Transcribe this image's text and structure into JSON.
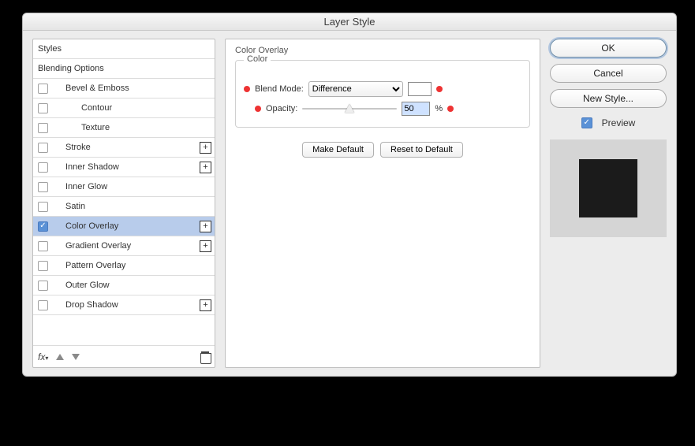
{
  "window": {
    "title": "Layer Style"
  },
  "left": {
    "styles_header": "Styles",
    "blending_options": "Blending Options",
    "items": [
      {
        "label": "Bevel & Emboss",
        "checked": false,
        "plus": false,
        "indent": 1
      },
      {
        "label": "Contour",
        "checked": false,
        "plus": false,
        "indent": 2
      },
      {
        "label": "Texture",
        "checked": false,
        "plus": false,
        "indent": 2
      },
      {
        "label": "Stroke",
        "checked": false,
        "plus": true,
        "indent": 1
      },
      {
        "label": "Inner Shadow",
        "checked": false,
        "plus": true,
        "indent": 1
      },
      {
        "label": "Inner Glow",
        "checked": false,
        "plus": false,
        "indent": 1
      },
      {
        "label": "Satin",
        "checked": false,
        "plus": false,
        "indent": 1
      },
      {
        "label": "Color Overlay",
        "checked": true,
        "plus": true,
        "indent": 1,
        "selected": true
      },
      {
        "label": "Gradient Overlay",
        "checked": false,
        "plus": true,
        "indent": 1
      },
      {
        "label": "Pattern Overlay",
        "checked": false,
        "plus": false,
        "indent": 1
      },
      {
        "label": "Outer Glow",
        "checked": false,
        "plus": false,
        "indent": 1
      },
      {
        "label": "Drop Shadow",
        "checked": false,
        "plus": true,
        "indent": 1
      }
    ],
    "fx_label": "fx"
  },
  "center": {
    "groupbox_title": "Color Overlay",
    "inner_title": "Color",
    "blend_label": "Blend Mode:",
    "blend_value": "Difference",
    "opacity_label": "Opacity:",
    "opacity_value": "50",
    "opacity_percent": 50,
    "pct_symbol": "%",
    "make_default": "Make Default",
    "reset_default": "Reset to Default",
    "swatch_color": "#ffffff"
  },
  "right": {
    "ok": "OK",
    "cancel": "Cancel",
    "new_style": "New Style...",
    "preview_label": "Preview",
    "preview_checked": true
  }
}
